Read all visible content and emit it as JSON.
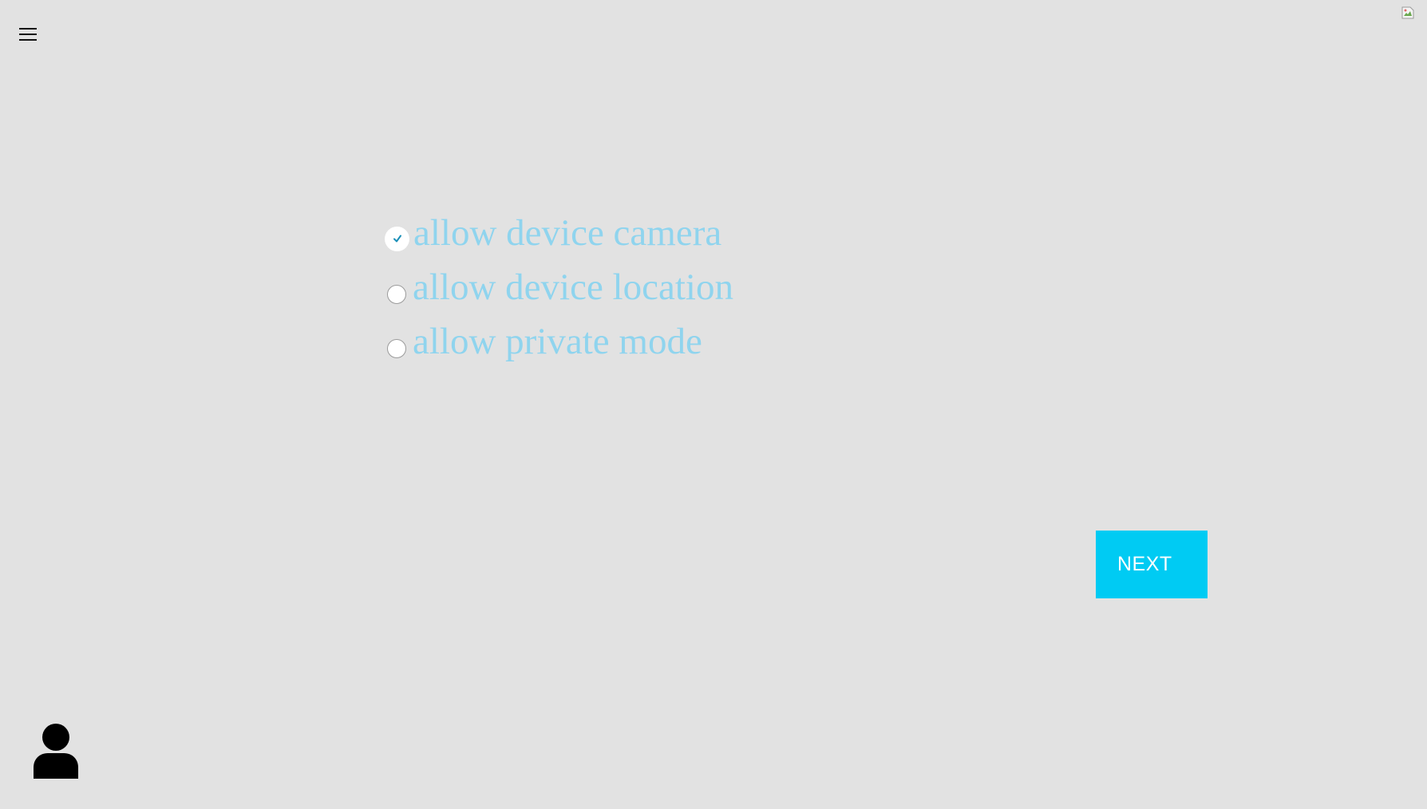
{
  "header": {
    "menu_icon": "hamburger-menu-icon",
    "corner_image_icon": "broken-image-icon"
  },
  "options": [
    {
      "label": "allow device camera",
      "checked": true
    },
    {
      "label": "allow device location",
      "checked": false
    },
    {
      "label": "allow private mode",
      "checked": false
    }
  ],
  "actions": {
    "next_label": "NEXT"
  },
  "footer": {
    "avatar_icon": "user-avatar-icon"
  },
  "colors": {
    "background": "#e2e2e2",
    "option_text": "#8fd4ee",
    "next_button": "#00cbf3",
    "check_mark": "#1a8fb8"
  }
}
